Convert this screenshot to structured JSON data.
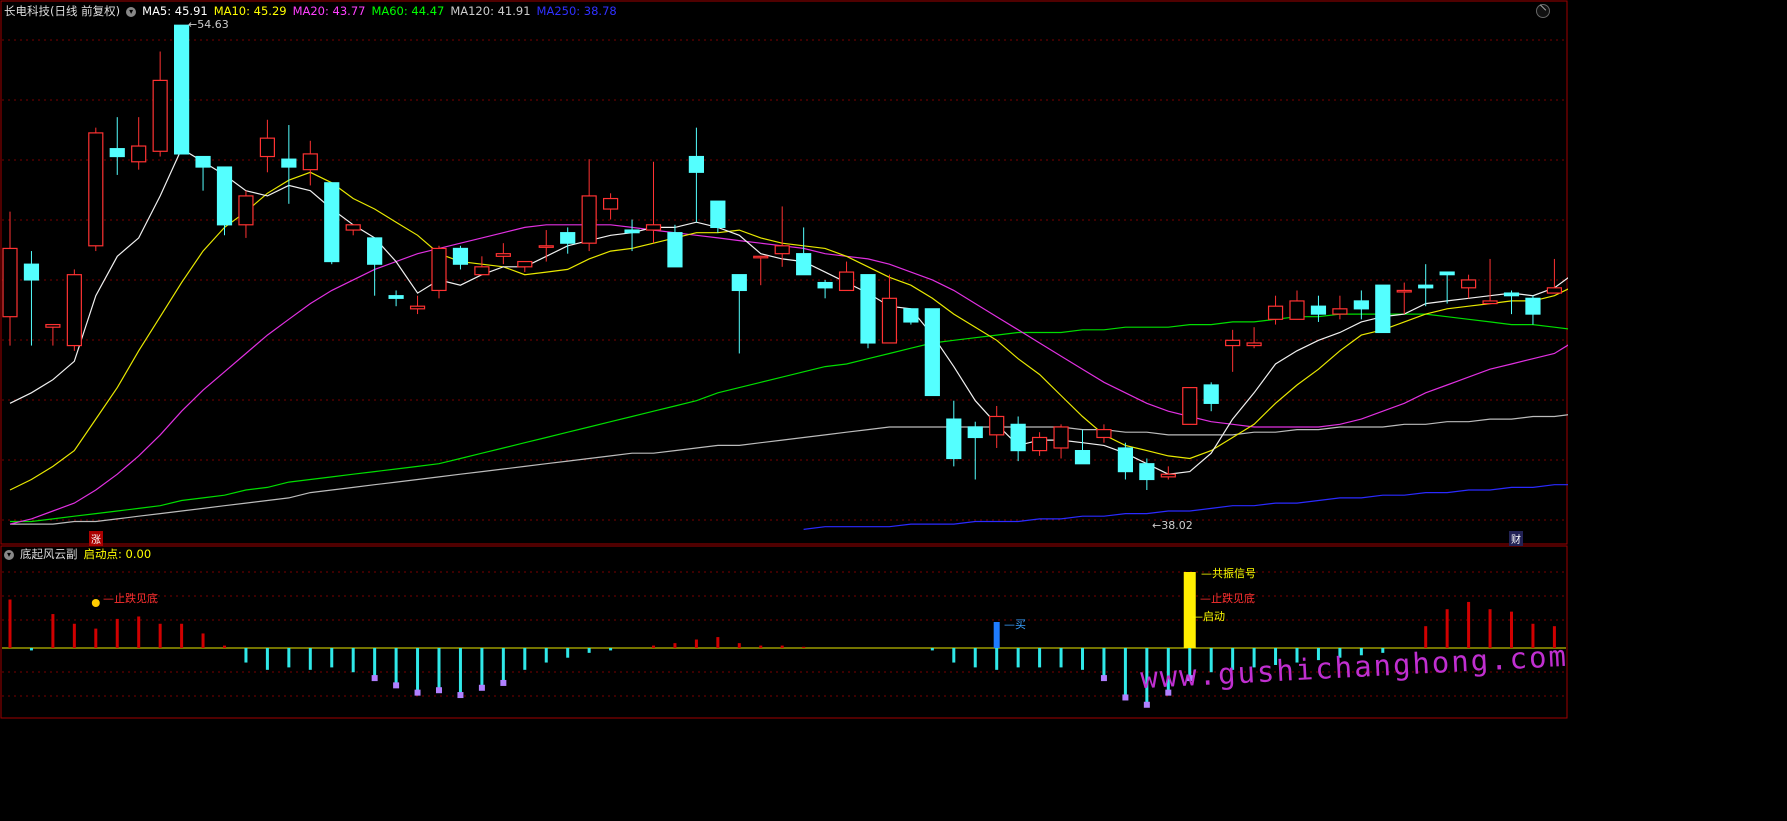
{
  "header": {
    "title": "长电科技(日线 前复权)",
    "ma": [
      {
        "label": "MA5: 45.91",
        "color": "#ffffff"
      },
      {
        "label": "MA10: 45.29",
        "color": "#ffff00"
      },
      {
        "label": "MA20: 43.77",
        "color": "#ff40ff"
      },
      {
        "label": "MA60: 44.47",
        "color": "#00ff00"
      },
      {
        "label": "MA120: 41.91",
        "color": "#cccccc"
      },
      {
        "label": "MA250: 38.78",
        "color": "#3030ff"
      }
    ]
  },
  "sub_header": {
    "title": "底起风云副",
    "indicator_label": "启动点: 0.00",
    "indicator_color": "#ffff00"
  },
  "annotations": {
    "high": "54.63",
    "low": "38.02",
    "zhang": "涨",
    "cai": "财",
    "stop_fall_1": "止跌见底",
    "stop_fall_2": "止跌见底",
    "buy": "买",
    "resonance": "共振信号",
    "launch": "启动"
  },
  "watermark": "www.gushichanghong.com",
  "colors": {
    "up": "#ff3232",
    "down": "#54ffff",
    "grid": "#7a0000",
    "axis": "#a00000"
  },
  "chart_data": {
    "type": "candlestick",
    "ylim": [
      37,
      56.5
    ],
    "candles": [
      [
        45.2,
        47.8,
        44.1,
        49.2
      ],
      [
        47.2,
        46.6,
        44.1,
        47.7
      ],
      [
        44.8,
        44.9,
        44.1,
        44.9
      ],
      [
        44.1,
        46.8,
        43.9,
        47.0
      ],
      [
        47.9,
        52.2,
        47.7,
        52.4
      ],
      [
        51.6,
        51.3,
        50.6,
        52.8
      ],
      [
        51.1,
        51.7,
        50.8,
        52.8
      ],
      [
        51.5,
        54.2,
        51.3,
        55.3
      ],
      [
        56.3,
        51.4,
        51.4,
        56.3
      ],
      [
        51.3,
        50.9,
        50.0,
        51.3
      ],
      [
        50.9,
        48.7,
        48.3,
        50.9
      ],
      [
        48.7,
        49.8,
        48.2,
        50.0
      ],
      [
        51.3,
        52.0,
        50.7,
        52.7
      ],
      [
        51.2,
        50.9,
        49.5,
        52.5
      ],
      [
        50.8,
        51.4,
        50.2,
        51.9
      ],
      [
        50.3,
        47.3,
        47.2,
        50.3
      ],
      [
        48.5,
        48.7,
        48.3,
        48.7
      ],
      [
        48.2,
        47.2,
        46.0,
        48.2
      ],
      [
        46.0,
        45.9,
        45.6,
        46.2
      ],
      [
        45.5,
        45.6,
        45.3,
        46.0
      ],
      [
        46.2,
        47.8,
        45.9,
        47.9
      ],
      [
        47.8,
        47.2,
        47.0,
        47.9
      ],
      [
        46.8,
        47.1,
        47.1,
        47.5
      ],
      [
        47.5,
        47.6,
        47.2,
        48.0
      ],
      [
        47.1,
        47.3,
        46.9,
        47.3
      ],
      [
        47.9,
        47.9,
        47.3,
        48.5
      ],
      [
        48.4,
        48.0,
        47.6,
        48.6
      ],
      [
        48.0,
        49.8,
        47.7,
        51.2
      ],
      [
        49.3,
        49.7,
        48.9,
        49.9
      ],
      [
        48.5,
        48.4,
        47.7,
        48.9
      ],
      [
        48.5,
        48.7,
        48.0,
        51.1
      ],
      [
        48.4,
        47.1,
        47.1,
        48.7
      ],
      [
        51.3,
        50.7,
        48.8,
        52.4
      ],
      [
        49.6,
        48.6,
        48.4,
        49.6
      ],
      [
        46.8,
        46.2,
        43.8,
        46.8
      ],
      [
        47.5,
        47.5,
        46.4,
        47.5
      ],
      [
        47.6,
        47.9,
        47.1,
        49.4
      ],
      [
        47.6,
        46.8,
        46.8,
        48.6
      ],
      [
        46.5,
        46.3,
        45.9,
        46.6
      ],
      [
        46.2,
        46.9,
        46.3,
        47.3
      ],
      [
        46.8,
        44.2,
        44.0,
        46.8
      ],
      [
        44.2,
        45.9,
        44.2,
        46.8
      ],
      [
        45.5,
        45.0,
        44.9,
        45.5
      ],
      [
        45.5,
        42.2,
        42.2,
        45.5
      ],
      [
        41.3,
        39.8,
        39.5,
        42.0
      ],
      [
        41.0,
        40.6,
        39.0,
        41.2
      ],
      [
        40.7,
        41.4,
        40.2,
        41.8
      ],
      [
        41.1,
        40.1,
        39.7,
        41.4
      ],
      [
        40.1,
        40.6,
        39.9,
        40.8
      ],
      [
        40.2,
        41.0,
        39.8,
        41.1
      ],
      [
        40.1,
        39.6,
        39.6,
        40.9
      ],
      [
        40.6,
        40.9,
        40.4,
        41.1
      ],
      [
        40.2,
        39.3,
        39.0,
        40.4
      ],
      [
        39.6,
        39.0,
        38.6,
        39.8
      ],
      [
        39.1,
        39.2,
        39.0,
        39.5
      ],
      [
        41.1,
        42.5,
        41.2,
        42.5
      ],
      [
        42.6,
        41.9,
        41.6,
        42.7
      ],
      [
        44.1,
        44.3,
        43.1,
        44.7
      ],
      [
        44.1,
        44.2,
        44.0,
        44.8
      ],
      [
        45.1,
        45.6,
        44.9,
        46.0
      ],
      [
        45.1,
        45.8,
        45.2,
        46.2
      ],
      [
        45.6,
        45.3,
        45.0,
        46.0
      ],
      [
        45.3,
        45.5,
        45.1,
        46.0
      ],
      [
        45.8,
        45.5,
        45.1,
        46.2
      ],
      [
        46.4,
        44.6,
        45.3,
        45.9
      ],
      [
        46.2,
        46.2,
        45.3,
        46.5
      ],
      [
        46.4,
        46.3,
        45.6,
        47.2
      ],
      [
        46.9,
        46.8,
        45.7,
        46.9
      ],
      [
        46.3,
        46.6,
        45.9,
        46.8
      ],
      [
        45.7,
        45.8,
        45.8,
        47.4
      ],
      [
        46.1,
        46.0,
        45.3,
        46.2
      ],
      [
        45.9,
        45.3,
        44.9,
        46.0
      ],
      [
        46.1,
        46.3,
        46.2,
        47.4
      ],
      [
        47.9,
        48.7,
        48.0,
        49.8
      ]
    ],
    "ma5": [
      41.9,
      42.3,
      42.8,
      43.5,
      46.0,
      47.5,
      48.2,
      49.8,
      51.6,
      51.1,
      50.6,
      50.0,
      49.8,
      50.2,
      50.0,
      49.3,
      48.7,
      48.2,
      47.3,
      46.1,
      46.6,
      46.4,
      46.8,
      47.1,
      47.1,
      47.5,
      47.9,
      48.1,
      48.3,
      48.4,
      48.6,
      48.6,
      48.8,
      48.6,
      48.3,
      47.6,
      47.4,
      47.3,
      46.9,
      46.5,
      46.1,
      45.6,
      45.5,
      44.5,
      43.3,
      42.0,
      41.1,
      40.3,
      40.5,
      40.5,
      40.4,
      40.3,
      40.0,
      39.6,
      39.2,
      39.3,
      40.0,
      41.3,
      42.3,
      43.4,
      43.9,
      44.3,
      44.6,
      45.0,
      45.2,
      45.3,
      45.7,
      45.8,
      45.9,
      46.0,
      46.1,
      46.0,
      46.3,
      46.9
    ],
    "ma10": [
      38.6,
      39.0,
      39.5,
      40.1,
      41.3,
      42.5,
      43.9,
      45.2,
      46.5,
      47.7,
      48.6,
      49.2,
      49.9,
      50.4,
      50.7,
      50.3,
      49.7,
      49.3,
      48.8,
      48.3,
      47.6,
      47.3,
      47.2,
      47.1,
      46.8,
      46.9,
      47.0,
      47.4,
      47.7,
      47.8,
      48.0,
      48.2,
      48.4,
      48.4,
      48.5,
      48.2,
      48.0,
      47.9,
      47.8,
      47.5,
      47.1,
      46.7,
      46.4,
      45.9,
      45.3,
      44.8,
      44.3,
      43.6,
      43.0,
      42.2,
      41.4,
      40.7,
      40.3,
      40.1,
      39.9,
      39.8,
      40.1,
      40.6,
      41.1,
      41.9,
      42.6,
      43.2,
      43.9,
      44.5,
      44.7,
      45.0,
      45.3,
      45.5,
      45.6,
      45.7,
      45.8,
      45.8,
      46.0,
      46.4
    ],
    "ma20": [
      37.3,
      37.5,
      37.8,
      38.1,
      38.6,
      39.2,
      39.9,
      40.7,
      41.6,
      42.4,
      43.1,
      43.8,
      44.5,
      45.1,
      45.7,
      46.2,
      46.6,
      47.0,
      47.3,
      47.6,
      47.8,
      48.0,
      48.2,
      48.4,
      48.6,
      48.7,
      48.7,
      48.7,
      48.7,
      48.6,
      48.5,
      48.4,
      48.3,
      48.2,
      48.1,
      48.0,
      47.9,
      47.8,
      47.6,
      47.5,
      47.4,
      47.2,
      46.9,
      46.6,
      46.2,
      45.7,
      45.2,
      44.7,
      44.2,
      43.7,
      43.2,
      42.7,
      42.3,
      41.9,
      41.6,
      41.4,
      41.2,
      41.1,
      41.0,
      41.0,
      41.0,
      41.0,
      41.1,
      41.3,
      41.6,
      41.9,
      42.3,
      42.6,
      42.9,
      43.2,
      43.4,
      43.6,
      43.8,
      44.3
    ],
    "ma60": [
      37.4,
      37.4,
      37.5,
      37.6,
      37.7,
      37.8,
      37.9,
      38.0,
      38.2,
      38.3,
      38.4,
      38.6,
      38.7,
      38.9,
      39.0,
      39.1,
      39.2,
      39.3,
      39.4,
      39.5,
      39.6,
      39.8,
      40.0,
      40.2,
      40.4,
      40.6,
      40.8,
      41.0,
      41.2,
      41.4,
      41.6,
      41.8,
      42.0,
      42.3,
      42.5,
      42.7,
      42.9,
      43.1,
      43.3,
      43.4,
      43.6,
      43.8,
      44.0,
      44.2,
      44.3,
      44.4,
      44.5,
      44.6,
      44.6,
      44.6,
      44.7,
      44.7,
      44.8,
      44.8,
      44.8,
      44.9,
      44.9,
      45.0,
      45.0,
      45.1,
      45.2,
      45.2,
      45.3,
      45.3,
      45.3,
      45.3,
      45.3,
      45.2,
      45.1,
      45.0,
      44.9,
      44.9,
      44.8,
      44.7
    ],
    "ma120": [
      37.3,
      37.3,
      37.3,
      37.4,
      37.4,
      37.5,
      37.6,
      37.7,
      37.8,
      37.9,
      38.0,
      38.1,
      38.2,
      38.3,
      38.5,
      38.6,
      38.7,
      38.8,
      38.9,
      39.0,
      39.1,
      39.2,
      39.3,
      39.4,
      39.5,
      39.6,
      39.7,
      39.8,
      39.9,
      40.0,
      40.0,
      40.1,
      40.2,
      40.3,
      40.3,
      40.4,
      40.5,
      40.6,
      40.7,
      40.8,
      40.9,
      41.0,
      41.0,
      41.0,
      41.0,
      41.0,
      41.0,
      41.0,
      41.0,
      41.0,
      40.9,
      40.9,
      40.8,
      40.8,
      40.7,
      40.7,
      40.7,
      40.7,
      40.8,
      40.8,
      40.9,
      40.9,
      41.0,
      41.0,
      41.0,
      41.1,
      41.1,
      41.2,
      41.2,
      41.3,
      41.3,
      41.4,
      41.4,
      41.5
    ],
    "ma250_x": [
      37,
      73
    ],
    "ma250": [
      37.1,
      37.2,
      37.2,
      37.2,
      37.2,
      37.3,
      37.3,
      37.3,
      37.4,
      37.4,
      37.4,
      37.5,
      37.5,
      37.6,
      37.6,
      37.7,
      37.7,
      37.8,
      37.8,
      37.9,
      38.0,
      38.0,
      38.1,
      38.1,
      38.2,
      38.3,
      38.3,
      38.4,
      38.4,
      38.5,
      38.5,
      38.6,
      38.6,
      38.7,
      38.7,
      38.8,
      38.8
    ],
    "osc_ylim": [
      -2.6,
      3.3
    ],
    "osc": [
      2.0,
      -0.1,
      1.4,
      1.0,
      0.8,
      1.2,
      1.3,
      1.0,
      1.0,
      0.6,
      0.1,
      -0.6,
      -0.9,
      -0.8,
      -0.9,
      -0.8,
      -1.0,
      -1.2,
      -1.5,
      -1.8,
      -1.7,
      -1.9,
      -1.6,
      -1.4,
      -0.9,
      -0.6,
      -0.4,
      -0.2,
      -0.1,
      0.0,
      0.1,
      0.2,
      0.35,
      0.45,
      0.2,
      0.1,
      0.1,
      0.05,
      0.0,
      0.0,
      0.0,
      0.0,
      0.0,
      -0.1,
      -0.6,
      -0.8,
      -0.9,
      -0.8,
      -0.8,
      -0.8,
      -0.9,
      -1.2,
      -2.0,
      -2.3,
      -1.8,
      -1.2,
      -1.0,
      -0.9,
      -0.8,
      -0.7,
      -0.6,
      -0.5,
      -0.4,
      -0.3,
      -0.2,
      0.0,
      0.9,
      1.6,
      1.9,
      1.6,
      1.5,
      1.0,
      0.9,
      0.6,
      0.4
    ]
  }
}
